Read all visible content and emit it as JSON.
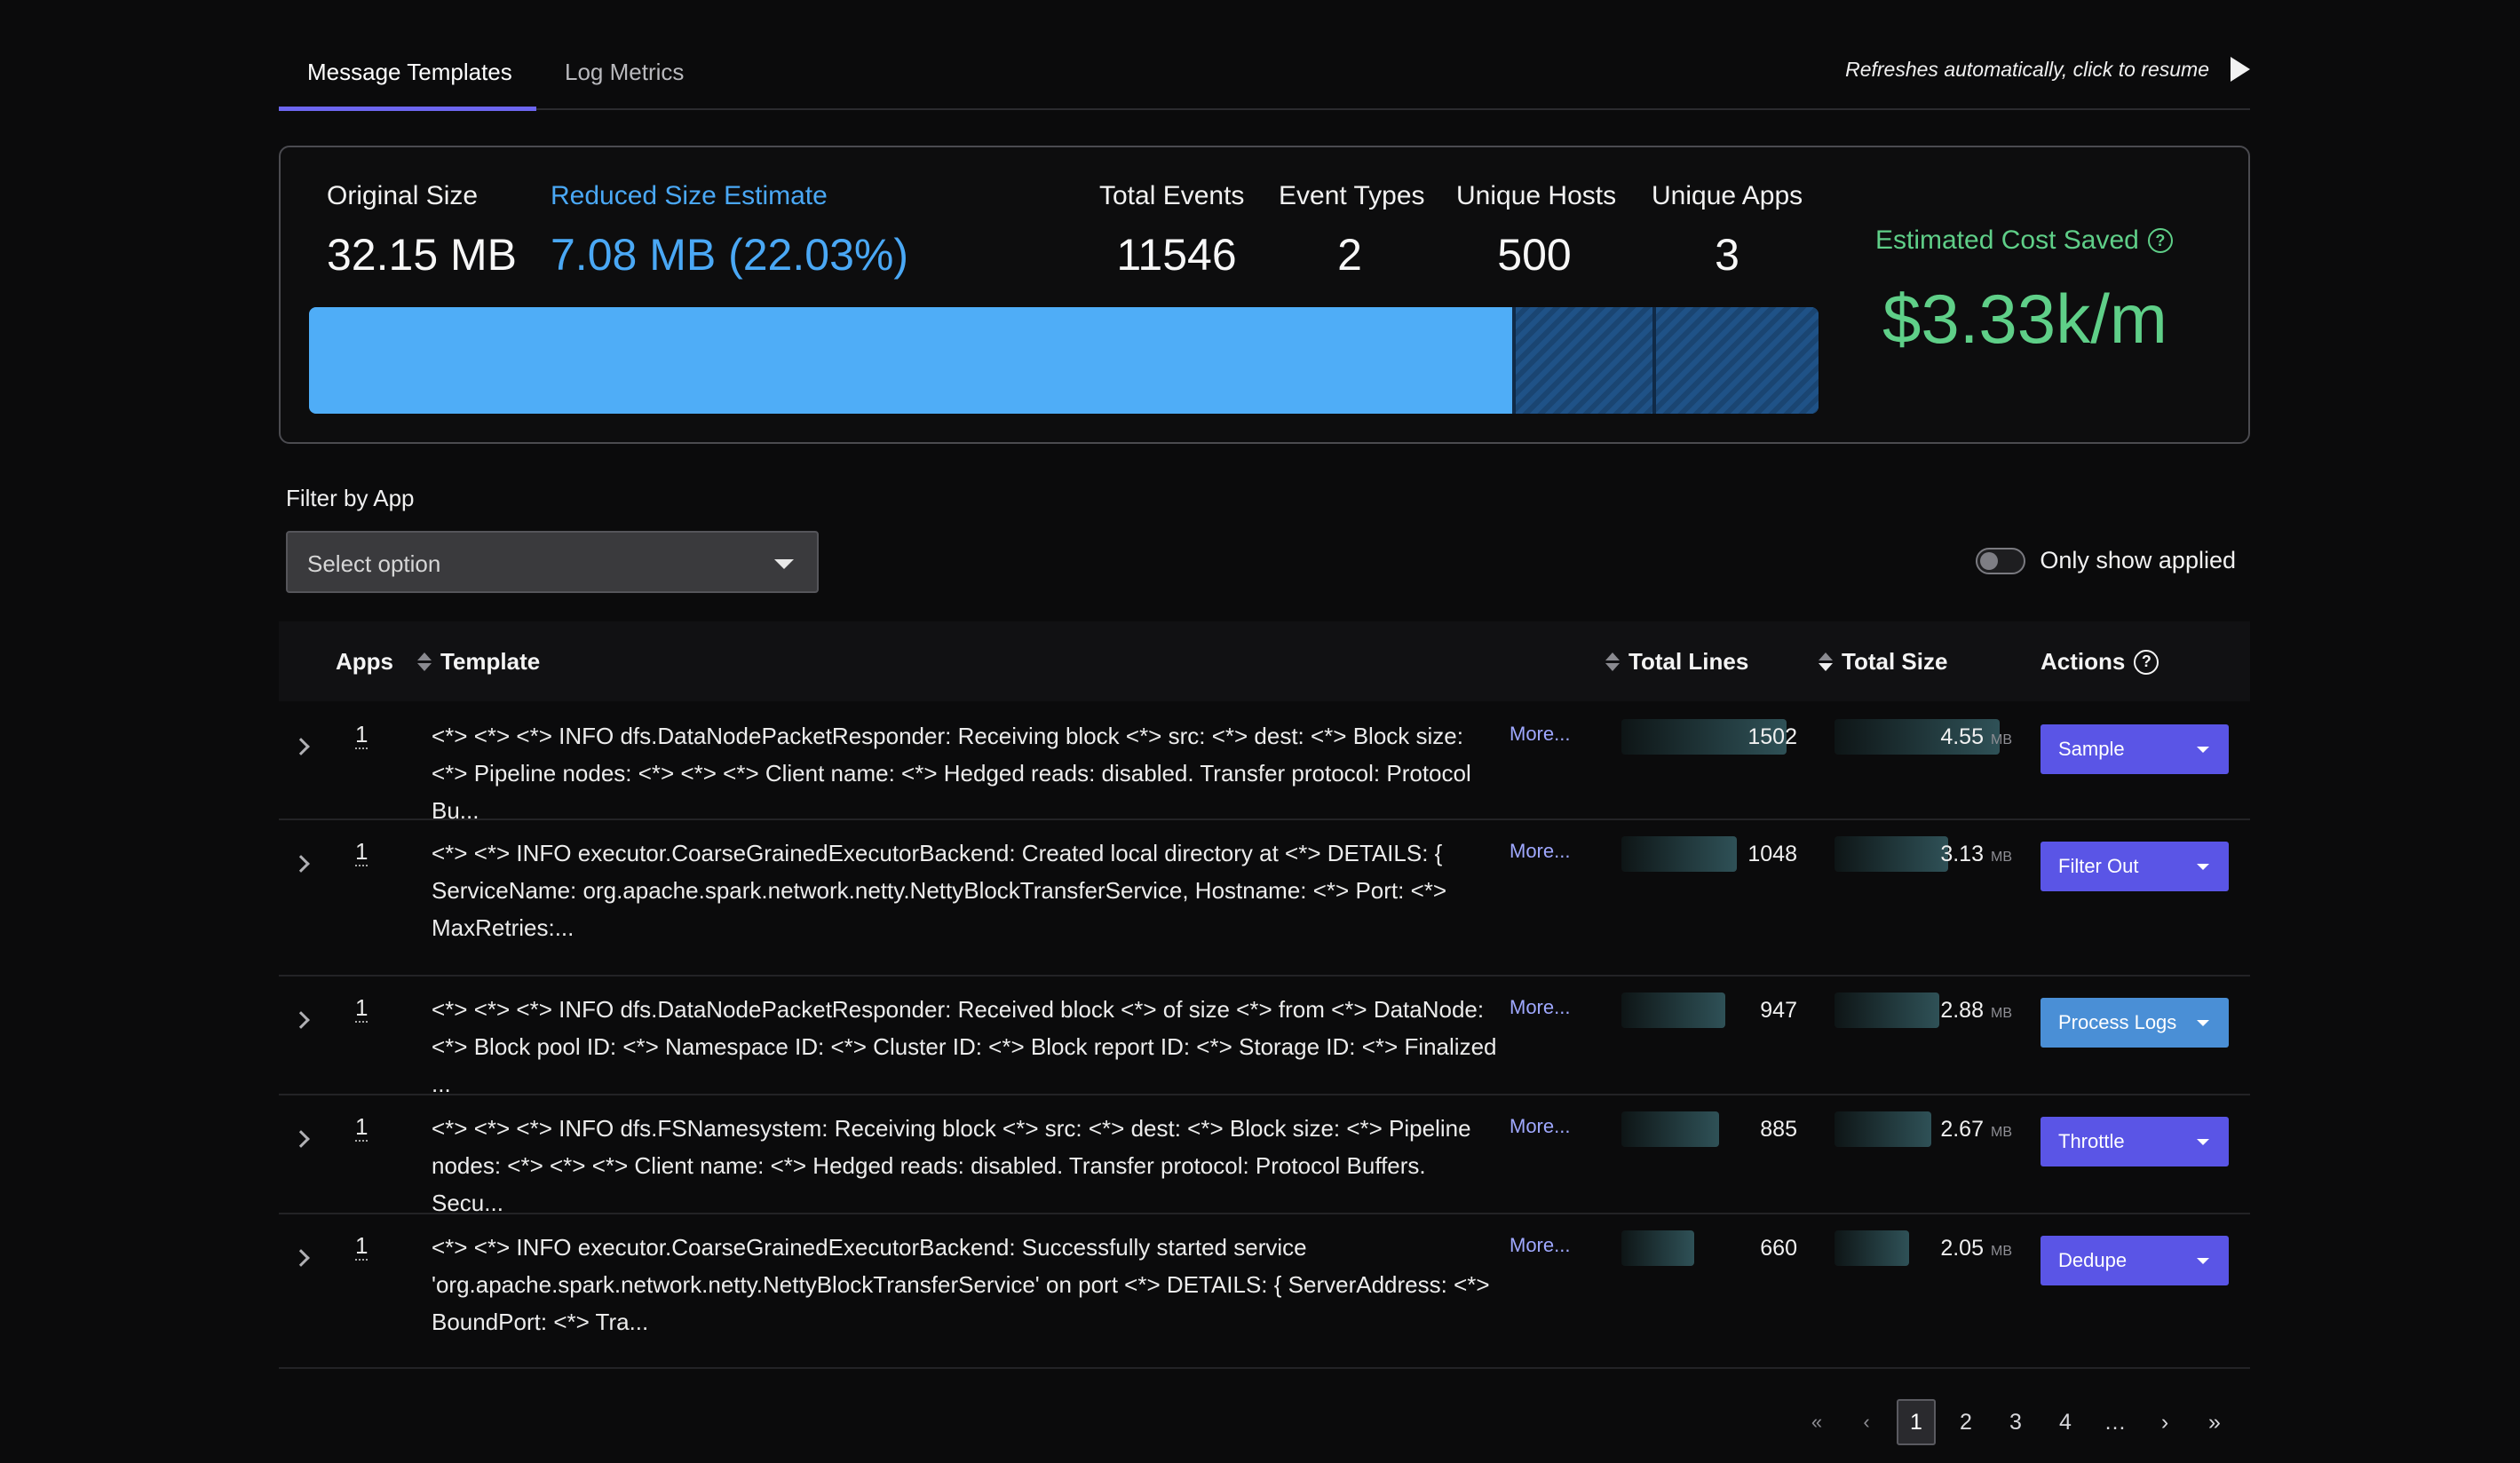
{
  "tabs": [
    {
      "label": "Message Templates",
      "active": true
    },
    {
      "label": "Log Metrics",
      "active": false
    }
  ],
  "refresh": {
    "text": "Refreshes automatically, click to resume",
    "icon": "play-icon"
  },
  "stats": {
    "original_size": {
      "label": "Original Size",
      "value": "32.15 MB"
    },
    "reduced_size": {
      "label": "Reduced Size Estimate",
      "value": "7.08 MB (22.03%)"
    },
    "total_events": {
      "label": "Total Events",
      "value": "11546"
    },
    "event_types": {
      "label": "Event Types",
      "value": "2"
    },
    "unique_hosts": {
      "label": "Unique Hosts",
      "value": "500"
    },
    "unique_apps": {
      "label": "Unique Apps",
      "value": "3"
    },
    "cost_saved": {
      "label": "Estimated Cost Saved",
      "value": "$3.33k/m"
    },
    "size_bar": {
      "fill_fraction": 0.797,
      "segment_fractions": [
        0.797,
        0.093,
        0.11
      ]
    }
  },
  "filter": {
    "label": "Filter by App",
    "placeholder": "Select option"
  },
  "toggle": {
    "label": "Only show applied",
    "on": false
  },
  "table": {
    "headers": {
      "apps": "Apps",
      "template": "Template",
      "total_lines": "Total Lines",
      "total_size": "Total Size",
      "actions": "Actions"
    },
    "more_label": "More...",
    "size_unit": "MB",
    "max_lines": 1502,
    "max_size": 4.55,
    "rows": [
      {
        "apps": "1",
        "template": "<*> <*> <*> INFO dfs.DataNodePacketResponder: Receiving block <*> src: <*> dest: <*> Block size: <*> Pipeline nodes: <*> <*> <*> Client name: <*> Hedged reads: disabled. Transfer protocol: Protocol Bu...",
        "lines": "1502",
        "size": "4.55",
        "action": "Sample"
      },
      {
        "apps": "1",
        "template": "<*> <*> INFO executor.CoarseGrainedExecutorBackend: Created local directory at <*> DETAILS: { ServiceName: org.apache.spark.network.netty.NettyBlockTransferService, Hostname: <*> Port: <*> MaxRetries:...",
        "lines": "1048",
        "size": "3.13",
        "action": "Filter Out"
      },
      {
        "apps": "1",
        "template": "<*> <*> <*> INFO dfs.DataNodePacketResponder: Received block <*> of size <*> from <*> DataNode: <*> Block pool ID: <*> Namespace ID: <*> Cluster ID: <*> Block report ID: <*> Storage ID: <*> Finalized ...",
        "lines": "947",
        "size": "2.88",
        "action": "Process Logs"
      },
      {
        "apps": "1",
        "template": "<*> <*> <*> INFO dfs.FSNamesystem: Receiving block <*> src: <*> dest: <*> Block size: <*> Pipeline nodes: <*> <*> <*> Client name: <*> Hedged reads: disabled. Transfer protocol: Protocol Buffers. Secu...",
        "lines": "885",
        "size": "2.67",
        "action": "Throttle"
      },
      {
        "apps": "1",
        "template": "<*> <*> INFO executor.CoarseGrainedExecutorBackend: Successfully started service 'org.apache.spark.network.netty.NettyBlockTransferService' on port <*> DETAILS: { ServerAddress: <*> BoundPort: <*> Tra...",
        "lines": "660",
        "size": "2.05",
        "action": "Dedupe"
      }
    ]
  },
  "pagination": {
    "first": "«",
    "prev": "‹",
    "pages": [
      "1",
      "2",
      "3",
      "4"
    ],
    "current": "1",
    "ellipsis": "…",
    "next": "›",
    "last": "»"
  }
}
